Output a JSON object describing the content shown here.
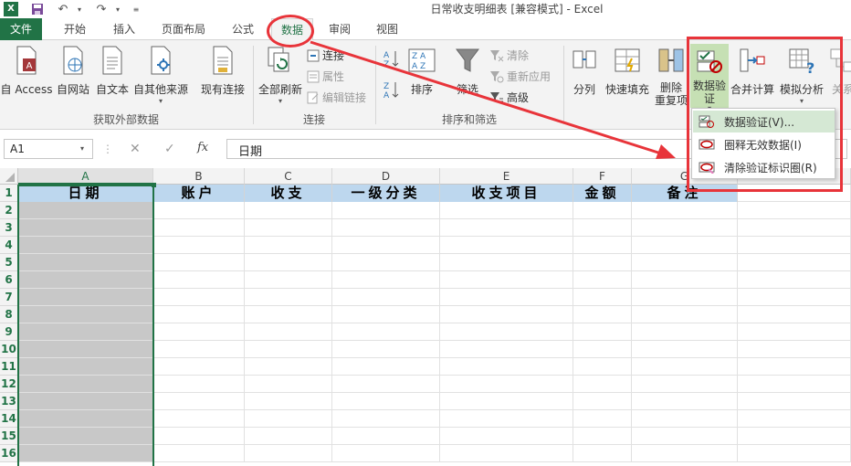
{
  "window": {
    "title": "日常收支明细表 [兼容模式] - Excel",
    "app_logo": "X"
  },
  "qat": {
    "save_icon": "save-icon",
    "undo_icon": "undo-icon",
    "redo_icon": "redo-icon"
  },
  "tabs": [
    {
      "label": "文件"
    },
    {
      "label": "开始"
    },
    {
      "label": "插入"
    },
    {
      "label": "页面布局"
    },
    {
      "label": "公式"
    },
    {
      "label": "数据"
    },
    {
      "label": "审阅"
    },
    {
      "label": "视图"
    }
  ],
  "ribbon": {
    "external": {
      "access": "自 Access",
      "web": "自网站",
      "text": "自文本",
      "other": "自其他来源",
      "existing": "现有连接",
      "group": "获取外部数据"
    },
    "connections": {
      "refresh_all": "全部刷新",
      "connections": "连接",
      "properties": "属性",
      "edit_links": "编辑链接",
      "group": "连接"
    },
    "sort_filter": {
      "sort": "排序",
      "filter": "筛选",
      "clear": "清除",
      "reapply": "重新应用",
      "advanced": "高级",
      "group": "排序和筛选"
    },
    "data_tools": {
      "text_to_columns": "分列",
      "flash_fill": "快速填充",
      "remove_dup_1": "删除",
      "remove_dup_2": "重复项",
      "validation_1": "数据验",
      "validation_2": "证",
      "consolidate": "合并计算",
      "what_if": "模拟分析",
      "relationships": "关系"
    }
  },
  "dropdown": {
    "items": [
      {
        "label": "数据验证(V)..."
      },
      {
        "label": "圈释无效数据(I)"
      },
      {
        "label": "清除验证标识圈(R)"
      }
    ]
  },
  "formula_bar": {
    "name_box": "A1",
    "cancel": "✕",
    "enter": "✓",
    "fx": "fx",
    "value": "日期"
  },
  "sheet": {
    "columns": [
      "A",
      "B",
      "C",
      "D",
      "E",
      "F",
      "G"
    ],
    "rows": [
      "1",
      "2",
      "3",
      "4",
      "5",
      "6",
      "7",
      "8",
      "9",
      "10",
      "11",
      "12",
      "13",
      "14",
      "15",
      "16"
    ],
    "headers": [
      "日期",
      "账户",
      "收支",
      "一级分类",
      "收支项目",
      "金额",
      "备注"
    ]
  },
  "colors": {
    "accent": "#217346",
    "header_fill": "#bdd7ee",
    "annotation": "#e8343a"
  }
}
